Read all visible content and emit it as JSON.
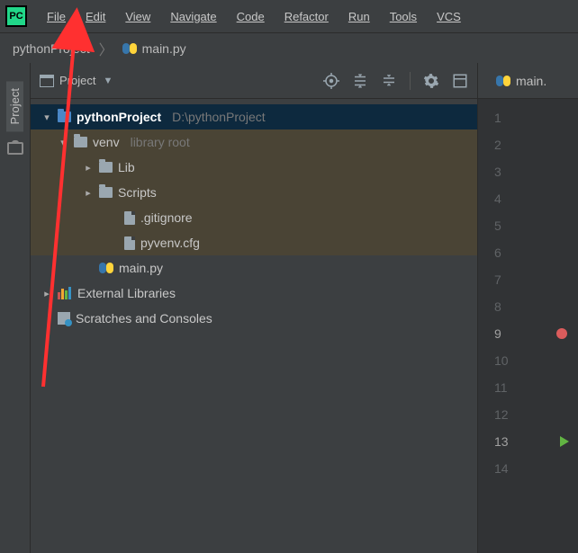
{
  "menu": {
    "items": [
      "File",
      "Edit",
      "View",
      "Navigate",
      "Code",
      "Refactor",
      "Run",
      "Tools",
      "VCS"
    ]
  },
  "breadcrumb": {
    "project": "pythonProject",
    "file": "main.py"
  },
  "left_gutter": {
    "project_label": "Project"
  },
  "project_panel": {
    "title": "Project"
  },
  "tree": {
    "root_name": "pythonProject",
    "root_path": "D:\\pythonProject",
    "venv": "venv",
    "venv_hint": "library root",
    "lib": "Lib",
    "scripts": "Scripts",
    "gitignore": ".gitignore",
    "pyvenv": "pyvenv.cfg",
    "mainpy": "main.py",
    "extlib": "External Libraries",
    "scratch": "Scratches and Consoles"
  },
  "editor": {
    "tab_label": "main.",
    "lines": [
      "1",
      "2",
      "3",
      "4",
      "5",
      "6",
      "7",
      "8",
      "9",
      "10",
      "11",
      "12",
      "13",
      "14"
    ],
    "breakpoint_line": 9,
    "run_line": 13
  }
}
